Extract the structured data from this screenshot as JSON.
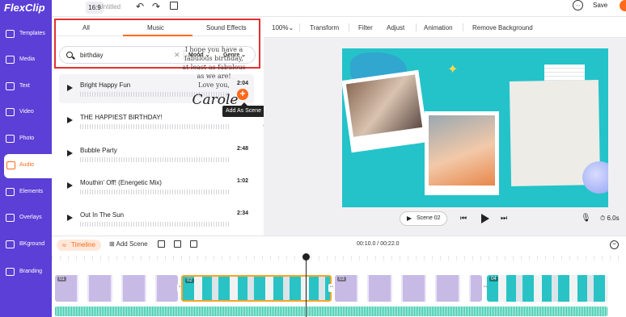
{
  "app": {
    "logo": "FlexClip",
    "ratio": "16:9",
    "project_name": "Untitled",
    "save_label": "Save"
  },
  "nav": [
    {
      "label": "Templates",
      "icon": "templates-icon"
    },
    {
      "label": "Media",
      "icon": "media-icon"
    },
    {
      "label": "Text",
      "icon": "text-icon"
    },
    {
      "label": "Video",
      "icon": "video-icon"
    },
    {
      "label": "Photo",
      "icon": "photo-icon"
    },
    {
      "label": "Audio",
      "icon": "audio-icon",
      "active": true
    },
    {
      "label": "Elements",
      "icon": "elements-icon"
    },
    {
      "label": "Overlays",
      "icon": "overlays-icon"
    },
    {
      "label": "BKground",
      "icon": "background-icon"
    },
    {
      "label": "Branding",
      "icon": "branding-icon"
    }
  ],
  "audio_panel": {
    "tabs": [
      "All",
      "Music",
      "Sound Effects"
    ],
    "active_tab": "Music",
    "search_value": "birthday",
    "filters": [
      "Mood",
      "Genre"
    ],
    "tracks": [
      {
        "name": "Bright Happy Fun",
        "duration": "2:04"
      },
      {
        "name": "THE HAPPIEST BIRTHDAY!",
        "duration": ""
      },
      {
        "name": "Bubble Party",
        "duration": "2:48"
      },
      {
        "name": "Mouthin' Off! (Energetic Mix)",
        "duration": "1:02"
      },
      {
        "name": "Out In The Sun",
        "duration": "2:34"
      }
    ],
    "tooltip": "Add As Scene"
  },
  "toolbar": {
    "zoom": "100%",
    "items": [
      "Transform",
      "Filter",
      "Adjust",
      "Animation",
      "Remove Background"
    ]
  },
  "canvas": {
    "note_lines": [
      "I hope you have a",
      "fabulous birthday,",
      "at least as fabulous",
      "as we are!",
      "Love you,"
    ],
    "signature": "Carole"
  },
  "player": {
    "scene_label": "Scene 02",
    "duration": "6.0s"
  },
  "timeline": {
    "label": "Timeline",
    "add_scene": "Add Scene",
    "timecode": "00:10.0 / 00:22.0",
    "clip_tags": [
      "01",
      "02",
      "03",
      "04"
    ]
  },
  "colors": {
    "brand": "#5b3fd6",
    "accent": "#ff6a1a",
    "scene_bg": "#24c3c9",
    "highlight": "#e23030"
  }
}
